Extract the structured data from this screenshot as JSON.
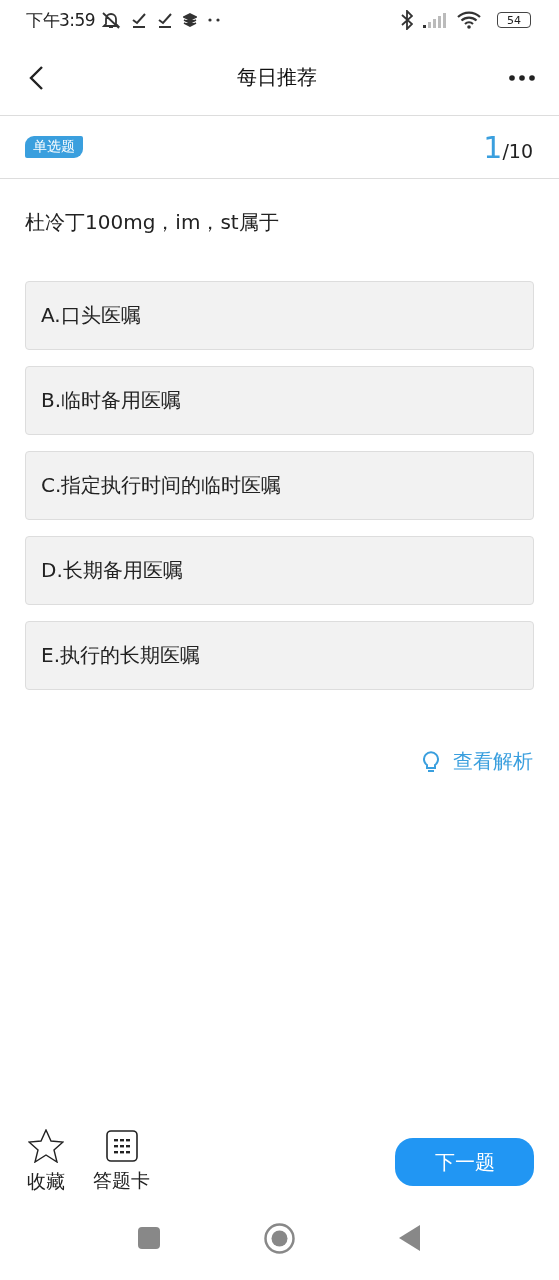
{
  "status_bar": {
    "time": "下午3:59",
    "battery": "54"
  },
  "header": {
    "title": "每日推荐"
  },
  "question": {
    "type_tag": "单选题",
    "current": "1",
    "total": "/10",
    "text": "杜冷丁100mg，im，st属于",
    "options": [
      {
        "label": "A.口头医嘱",
        "selected": false
      },
      {
        "label": "B.临时备用医嘱",
        "selected": false
      },
      {
        "label": "C.指定执行时间的临时医嘱",
        "selected": false
      },
      {
        "label": "D.长期备用医嘱",
        "selected": false
      },
      {
        "label": "E.执行的长期医嘱",
        "selected": false
      }
    ],
    "hint_link": "查看解析"
  },
  "bottom_bar": {
    "favorite": "收藏",
    "answer_card": "答题卡",
    "next_button": "下一题"
  }
}
